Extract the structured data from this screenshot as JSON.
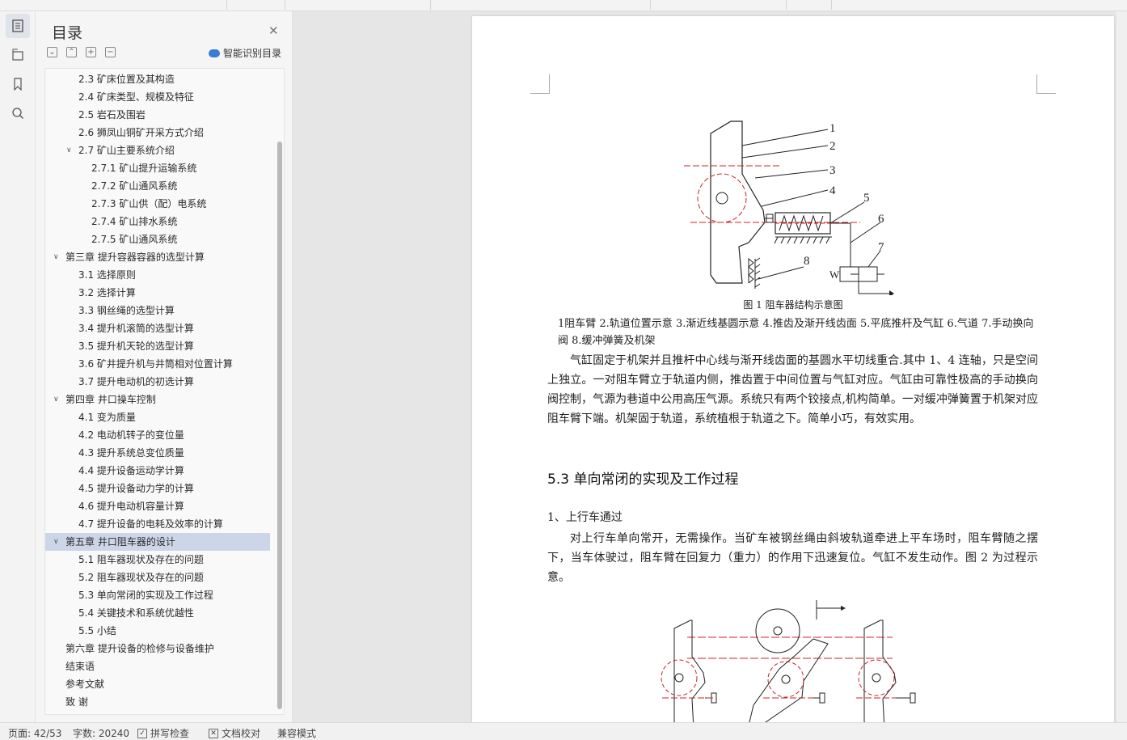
{
  "panel": {
    "title": "目录",
    "close_icon": "✕",
    "smart_toc": "智能识别目录"
  },
  "toc": [
    {
      "text": "2.3  矿床位置及其构造",
      "level": 2
    },
    {
      "text": "2.4  矿床类型、规模及特征",
      "level": 2
    },
    {
      "text": "2.5  岩石及围岩",
      "level": 2
    },
    {
      "text": "2.6  狮凤山铜矿开采方式介绍",
      "level": 2
    },
    {
      "text": "2.7  矿山主要系统介绍",
      "level": 2,
      "expanded": true
    },
    {
      "text": "2.7.1   矿山提升运输系统",
      "level": 3
    },
    {
      "text": "2.7.2    矿山通风系统",
      "level": 3
    },
    {
      "text": "2.7.3    矿山供（配）电系统",
      "level": 3
    },
    {
      "text": "2.7.4    矿山排水系统",
      "level": 3
    },
    {
      "text": "2.7.5    矿山通风系统",
      "level": 3
    },
    {
      "text": "第三章  提升容器容器的选型计算",
      "level": 1,
      "expanded": true
    },
    {
      "text": "3.1  选择原则",
      "level": 2
    },
    {
      "text": "3.2  选择计算",
      "level": 2
    },
    {
      "text": "3.3  钢丝绳的选型计算",
      "level": 2
    },
    {
      "text": "3.4  提升机滚筒的选型计算",
      "level": 2
    },
    {
      "text": "3.5  提升机天轮的选型计算",
      "level": 2
    },
    {
      "text": "3.6  矿井提升机与井筒相对位置计算",
      "level": 2
    },
    {
      "text": "3.7  提升电动机的初选计算",
      "level": 2
    },
    {
      "text": "第四章  井口操车控制",
      "level": 1,
      "expanded": true
    },
    {
      "text": "4.1  变为质量",
      "level": 2
    },
    {
      "text": "4.2  电动机转子的变位量",
      "level": 2
    },
    {
      "text": "4.3  提升系统总变位质量",
      "level": 2
    },
    {
      "text": "4.4  提升设备运动学计算",
      "level": 2
    },
    {
      "text": "4.5  提升设备动力学的计算",
      "level": 2
    },
    {
      "text": "4.6  提升电动机容量计算",
      "level": 2
    },
    {
      "text": "4.7  提升设备的电耗及效率的计算",
      "level": 2
    },
    {
      "text": "第五章  井口阻车器的设计",
      "level": 1,
      "expanded": true,
      "selected": true
    },
    {
      "text": "5.1  阻车器现状及存在的问题",
      "level": 2
    },
    {
      "text": "5.2  阻车器现状及存在的问题",
      "level": 2
    },
    {
      "text": "5.3  单向常闭的实现及工作过程",
      "level": 2
    },
    {
      "text": "5.4  关键技术和系统优越性",
      "level": 2
    },
    {
      "text": "5.5  小结",
      "level": 2
    },
    {
      "text": "第六章  提升设备的检修与设备维护",
      "level": 1
    },
    {
      "text": "结束语",
      "level": 1
    },
    {
      "text": "参考文献",
      "level": 1
    },
    {
      "text": "致    谢",
      "level": 1
    }
  ],
  "document": {
    "figure1_labels": [
      "1",
      "2",
      "3",
      "4",
      "5",
      "6",
      "7",
      "8"
    ],
    "figure1_valve_label": "W",
    "figure1_caption": "图 1  阻车器结构示意图",
    "figure1_legend": "1阻车臂 2.轨道位置示意 3.渐近线基圆示意 4.推齿及渐开线齿面 5.平底推杆及气缸 6.气道 7.手动换向阀 8.缓冲弹簧及机架",
    "paragraph1": "气缸固定于机架并且推杆中心线与渐开线齿面的基圆水平切线重合.其中 1、4 连轴，只是空间上独立。一对阻车臂立于轨道内侧，推齿置于中间位置与气缸对应。气缸由可靠性极高的手动换向阀控制，气源为巷道中公用高压气源。系统只有两个铰接点,机构简单。一对缓冲弹簧置于机架对应阻车臂下端。机架固于轨道，系统植根于轨道之下。简单小巧，有效实用。",
    "heading": "5.3  单向常闭的实现及工作过程",
    "subheading": "1、上行车通过",
    "paragraph2": "对上行车单向常开，无需操作。当矿车被钢丝绳由斜坡轨道牵进上平车场时，阻车臂随之摆下，当车体驶过，阻车臂在回复力（重力）的作用下迅速复位。气缸不发生动作。图 2 为过程示意。"
  },
  "status": {
    "page": "页面: 42/53",
    "words": "字数: 20240",
    "spell": "拼写检查",
    "proof": "文档校对",
    "compat": "兼容模式"
  }
}
